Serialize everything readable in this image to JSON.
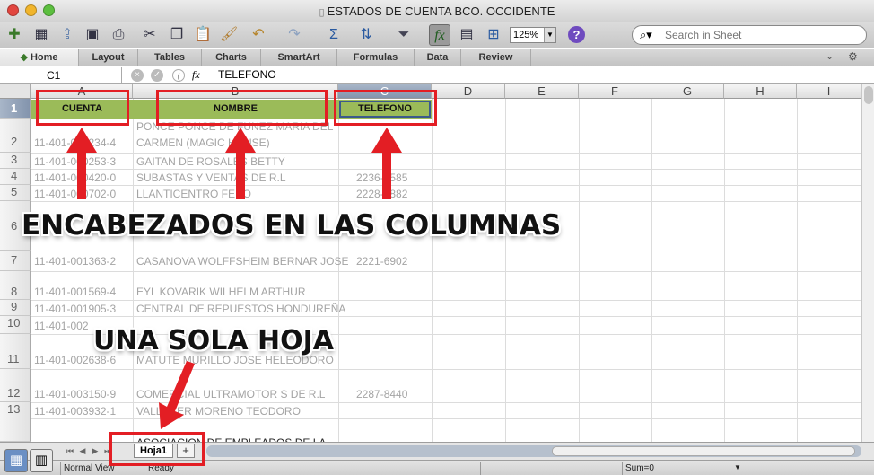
{
  "window": {
    "title": "ESTADOS DE CUENTA BCO. OCCIDENTE",
    "traffic_lights": [
      "#e2463f",
      "#f1b52c",
      "#5cbf3f"
    ]
  },
  "toolbar": {
    "icons": [
      "new-icon",
      "templates-icon",
      "open-icon",
      "save-icon",
      "print-icon",
      "cut-icon",
      "copy-icon",
      "paste-icon",
      "format-painter-icon",
      "undo-icon",
      "redo-icon",
      "autosum-icon",
      "sort-icon",
      "filter-icon",
      "formula-builder-icon",
      "toolbox-icon",
      "gallery-icon",
      "help-icon"
    ],
    "zoom": "125%",
    "search_placeholder": "Search in Sheet"
  },
  "ribbon": {
    "tabs": [
      "Home",
      "Layout",
      "Tables",
      "Charts",
      "SmartArt",
      "Formulas",
      "Data",
      "Review"
    ]
  },
  "formula_bar": {
    "name_box": "C1",
    "fx": "fx",
    "value": "TELEFONO"
  },
  "columns": [
    "A",
    "B",
    "C",
    "D",
    "E",
    "F",
    "G",
    "H",
    "I"
  ],
  "selected_column": "C",
  "rows": [
    "1",
    "2",
    "3",
    "4",
    "5",
    "6",
    "7",
    "8",
    "9",
    "10",
    "11",
    "12",
    "13"
  ],
  "header_row": [
    "CUENTA",
    "NOMBRE",
    "TELEFONO"
  ],
  "cells": {
    "r2b_top": "PONCE PONCE DE FUNEZ MARIA DEL",
    "r2a": "11-401-000234-4",
    "r2b": "CARMEN (MAGIC HOUSE)",
    "r3a": "11-401-000253-3",
    "r3b": "GAITAN DE ROSALES BETTY",
    "r4a": "11-401-000420-0",
    "r4b": "SUBASTAS Y VENTAS DE R.L",
    "r4c": "2236-5585",
    "r5a": "11-401-000702-0",
    "r5b": "LLANTICENTRO FERO",
    "r5c": "2228-1882",
    "r7a": "11-401-001363-2",
    "r7b": "CASANOVA WOLFFSHEIM BERNAR JOSE",
    "r7c": "2221-6902",
    "r8a": "11-401-001569-4",
    "r8b": "EYL KOVARIK WILHELM ARTHUR",
    "r9a": "11-401-001905-3",
    "r9b": "CENTRAL DE REPUESTOS HONDUREÑA",
    "r10a": "11-401-002",
    "r11a": "11-401-002638-6",
    "r11b": "MATUTE MURILLO JOSE HELEODORO",
    "r12a": "11-401-003150-9",
    "r12b": "COMERCIAL ULTRAMOTOR S DE R.L",
    "r12c": "2287-8440",
    "r13a": "11-401-003932-1",
    "r13b": "VALLECER MORENO TEODORO",
    "r14b": "ASOCIACION DE EMPLEADOS DE LA"
  },
  "annotations": {
    "columns": "ENCABEZADOS EN LAS COLUMNAS",
    "sheet": "UNA SOLA HOJA"
  },
  "sheet_tabs": {
    "active": "Hoja1",
    "add": "+"
  },
  "status": {
    "view": "Normal View",
    "state": "Ready",
    "sum": "Sum=0"
  }
}
